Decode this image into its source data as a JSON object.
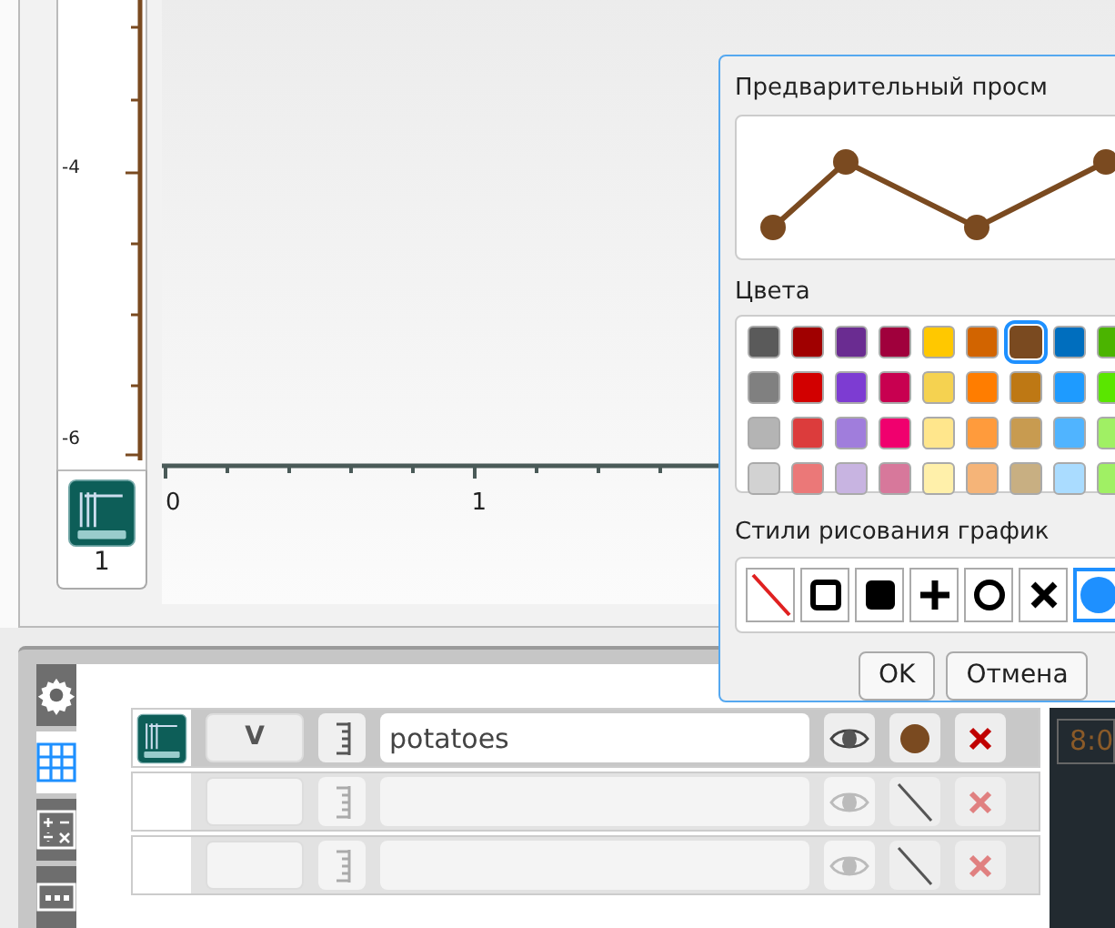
{
  "graph": {
    "y_axis_labels": [
      "-4",
      "-6"
    ],
    "x_axis_labels": [
      "0",
      "1"
    ],
    "sensor_number": "1"
  },
  "dialog": {
    "preview_title": "Предварительный просм",
    "colors_title": "Цвета",
    "colors": [
      {
        "color": "#5a5a5a",
        "selected": false
      },
      {
        "color": "#a00000",
        "selected": false
      },
      {
        "color": "#6a2c91",
        "selected": false
      },
      {
        "color": "#a0003c",
        "selected": false
      },
      {
        "color": "#ffc800",
        "selected": false
      },
      {
        "color": "#d26400",
        "selected": false
      },
      {
        "color": "#7a4a20",
        "selected": true
      },
      {
        "color": "#006ebe",
        "selected": false
      },
      {
        "color": "#4bb400",
        "selected": false
      },
      {
        "color": "#808080",
        "selected": false
      },
      {
        "color": "#d20000",
        "selected": false
      },
      {
        "color": "#7d3cd2",
        "selected": false
      },
      {
        "color": "#c80050",
        "selected": false
      },
      {
        "color": "#f5d250",
        "selected": false
      },
      {
        "color": "#ff7d00",
        "selected": false
      },
      {
        "color": "#be7814",
        "selected": false
      },
      {
        "color": "#1e9bff",
        "selected": false
      },
      {
        "color": "#5ae600",
        "selected": false
      },
      {
        "color": "#b4b4b4",
        "selected": false
      },
      {
        "color": "#dc3c3c",
        "selected": false
      },
      {
        "color": "#a07ddc",
        "selected": false
      },
      {
        "color": "#f0006e",
        "selected": false
      },
      {
        "color": "#ffe68c",
        "selected": false
      },
      {
        "color": "#ff9b3c",
        "selected": false
      },
      {
        "color": "#c89b50",
        "selected": false
      },
      {
        "color": "#50b4ff",
        "selected": false
      },
      {
        "color": "#a0f064",
        "selected": false
      },
      {
        "color": "#d2d2d2",
        "selected": false
      },
      {
        "color": "#eb7878",
        "selected": false
      },
      {
        "color": "#c8b4e1",
        "selected": false
      },
      {
        "color": "#d7789b",
        "selected": false
      },
      {
        "color": "#fff0aa",
        "selected": false
      },
      {
        "color": "#f5b478",
        "selected": false
      },
      {
        "color": "#c8af82",
        "selected": false
      },
      {
        "color": "#aadcff",
        "selected": false
      },
      {
        "color": "#a0f064",
        "selected": false
      }
    ],
    "styles_title": "Стили рисования график",
    "styles": [
      {
        "kind": "none",
        "selected": false
      },
      {
        "kind": "square",
        "selected": false
      },
      {
        "kind": "filled-square",
        "selected": false
      },
      {
        "kind": "plus",
        "selected": false
      },
      {
        "kind": "circle",
        "selected": false
      },
      {
        "kind": "cross",
        "selected": false
      },
      {
        "kind": "filled-circle",
        "selected": true
      }
    ],
    "buttons": [
      "OK",
      "Отмена"
    ]
  },
  "side_tabs": [
    {
      "kind": "settings",
      "selected": false
    },
    {
      "kind": "table",
      "selected": true
    },
    {
      "kind": "calculator",
      "selected": false
    },
    {
      "kind": "more",
      "selected": false
    }
  ],
  "rows": [
    {
      "active": true,
      "unit": "V",
      "name": "potatoes",
      "kind": "dot"
    },
    {
      "active": false,
      "kind": "none"
    },
    {
      "active": false,
      "kind": "none"
    }
  ],
  "readout": {
    "value": "8:0"
  }
}
